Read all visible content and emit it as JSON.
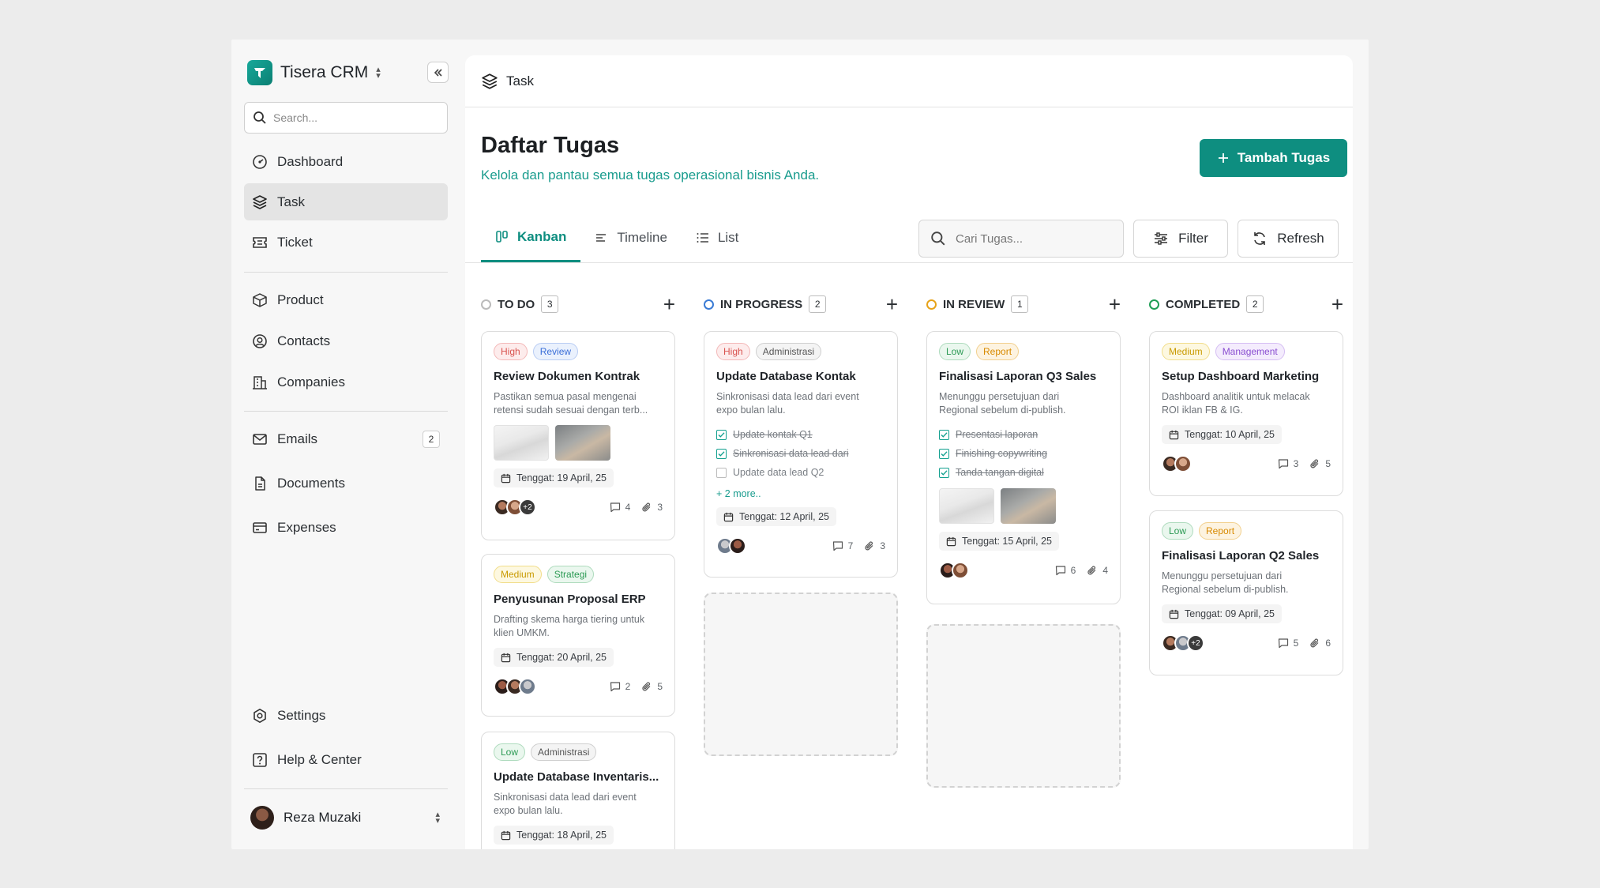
{
  "app": {
    "name": "Tisera CRM"
  },
  "sidebar": {
    "search_placeholder": "Search...",
    "items": [
      {
        "label": "Dashboard"
      },
      {
        "label": "Task"
      },
      {
        "label": "Ticket"
      },
      {
        "label": "Product"
      },
      {
        "label": "Contacts"
      },
      {
        "label": "Companies"
      },
      {
        "label": "Emails",
        "badge": "2"
      },
      {
        "label": "Documents"
      },
      {
        "label": "Expenses"
      },
      {
        "label": "Settings"
      },
      {
        "label": "Help & Center"
      }
    ],
    "user": {
      "name": "Reza Muzaki"
    }
  },
  "breadcrumb": {
    "label": "Task"
  },
  "page": {
    "title": "Daftar Tugas",
    "subtitle": "Kelola dan pantau semua tugas operasional bisnis Anda.",
    "add_button": "Tambah Tugas"
  },
  "tabs": [
    {
      "label": "Kanban"
    },
    {
      "label": "Timeline"
    },
    {
      "label": "List"
    }
  ],
  "toolbar": {
    "search_placeholder": "Cari Tugas...",
    "filter": "Filter",
    "refresh": "Refresh"
  },
  "colors": {
    "accent": "#0e8e80",
    "todo": "#bbbbbb",
    "in_progress": "#3a7bd5",
    "in_review": "#e7a31a",
    "completed": "#1f9d55"
  },
  "columns": [
    {
      "title": "TO DO",
      "count": "3",
      "cards": [
        {
          "tags": [
            "High",
            "Review"
          ],
          "title": "Review Dokumen Kontrak",
          "desc": [
            "Pastikan semua pasal mengenai",
            "retensi sudah sesuai dengan terb..."
          ],
          "due": "Tenggat: 19 April, 25",
          "avatar_more": "+2",
          "comments": "4",
          "attachments": "3"
        },
        {
          "tags": [
            "Medium",
            "Strategi"
          ],
          "title": "Penyusunan Proposal ERP",
          "desc": [
            "Drafting skema harga tiering untuk",
            "klien UMKM."
          ],
          "due": "Tenggat: 20 April, 25",
          "comments": "2",
          "attachments": "5"
        },
        {
          "tags": [
            "Low",
            "Administrasi"
          ],
          "title": "Update Database Inventaris...",
          "desc": [
            "Sinkronisasi data lead dari event",
            "expo bulan lalu."
          ],
          "due": "Tenggat: 18 April, 25"
        }
      ]
    },
    {
      "title": "IN PROGRESS",
      "count": "2",
      "cards": [
        {
          "tags": [
            "High",
            "Administrasi"
          ],
          "title": "Update Database Kontak",
          "desc": [
            "Sinkronisasi data lead dari event",
            "expo bulan lalu."
          ],
          "checklist": [
            "Update kontak Q1",
            "Sinkronisasi data lead dari",
            "Update data lead Q2"
          ],
          "more": "+ 2 more..",
          "due": "Tenggat: 12 April, 25",
          "comments": "7",
          "attachments": "3"
        }
      ]
    },
    {
      "title": "IN REVIEW",
      "count": "1",
      "cards": [
        {
          "tags": [
            "Low",
            "Report"
          ],
          "title": "Finalisasi Laporan Q3 Sales",
          "desc": [
            "Menunggu persetujuan dari",
            "Regional sebelum di-publish."
          ],
          "checklist": [
            "Presentasi laporan",
            "Finishing copywriting",
            "Tanda tangan digital"
          ],
          "due": "Tenggat: 15 April, 25",
          "comments": "6",
          "attachments": "4"
        }
      ]
    },
    {
      "title": "COMPLETED",
      "count": "2",
      "cards": [
        {
          "tags": [
            "Medium",
            "Management"
          ],
          "title": "Setup Dashboard Marketing",
          "desc": [
            "Dashboard analitik untuk melacak",
            "ROI iklan FB & IG."
          ],
          "due": "Tenggat: 10 April, 25",
          "comments": "3",
          "attachments": "5"
        },
        {
          "tags": [
            "Low",
            "Report"
          ],
          "title": "Finalisasi Laporan Q2 Sales",
          "desc": [
            "Menunggu persetujuan dari",
            "Regional sebelum di-publish."
          ],
          "due": "Tenggat: 09 April, 25",
          "avatar_more": "+2",
          "comments": "5",
          "attachments": "6"
        }
      ]
    }
  ]
}
